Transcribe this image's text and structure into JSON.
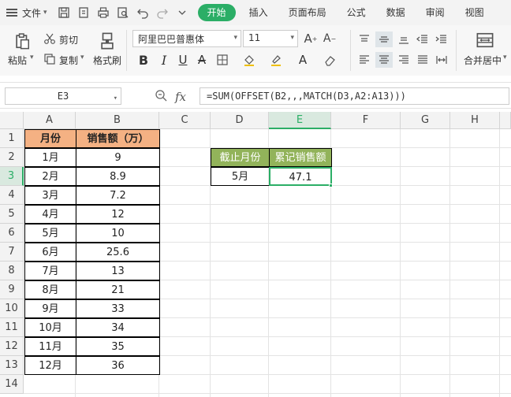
{
  "menubar": {
    "file_label": "文件",
    "tabs": [
      "开始",
      "插入",
      "页面布局",
      "公式",
      "数据",
      "审阅",
      "视图"
    ],
    "active_tab": "开始"
  },
  "ribbon": {
    "paste_label": "粘贴",
    "cut_label": "剪切",
    "copy_label": "复制",
    "format_painter_label": "格式刷",
    "font_name": "阿里巴巴普惠体",
    "font_size": "11",
    "merge_label": "合并居中"
  },
  "formula_bar": {
    "cell_ref": "E3",
    "fx_label": "fx",
    "formula": "=SUM(OFFSET(B2,,,MATCH(D3,A2:A13)))"
  },
  "grid": {
    "columns": [
      "A",
      "B",
      "C",
      "D",
      "E",
      "F",
      "G",
      "H"
    ],
    "rows": [
      "1",
      "2",
      "3",
      "4",
      "5",
      "6",
      "7",
      "8",
      "9",
      "10",
      "11",
      "12",
      "13",
      "14"
    ],
    "selected_column": "E",
    "selected_row": "3"
  },
  "table": {
    "header_month": "月份",
    "header_sales": "销售额（万）",
    "rows": [
      {
        "month": "1月",
        "sales": "9"
      },
      {
        "month": "2月",
        "sales": "8.9"
      },
      {
        "month": "3月",
        "sales": "7.2"
      },
      {
        "month": "4月",
        "sales": "12"
      },
      {
        "month": "5月",
        "sales": "10"
      },
      {
        "month": "6月",
        "sales": "25.6"
      },
      {
        "month": "7月",
        "sales": "13"
      },
      {
        "month": "8月",
        "sales": "21"
      },
      {
        "month": "9月",
        "sales": "33"
      },
      {
        "month": "10月",
        "sales": "34"
      },
      {
        "month": "11月",
        "sales": "35"
      },
      {
        "month": "12月",
        "sales": "36"
      }
    ]
  },
  "lookup": {
    "header_cutoff": "截止月份",
    "header_cumulative": "累记销售额",
    "cutoff_value": "5月",
    "cumulative_value": "47.1"
  },
  "colors": {
    "accent": "#2bae66",
    "header_orange": "#f4b183",
    "header_green": "#92b35a"
  }
}
